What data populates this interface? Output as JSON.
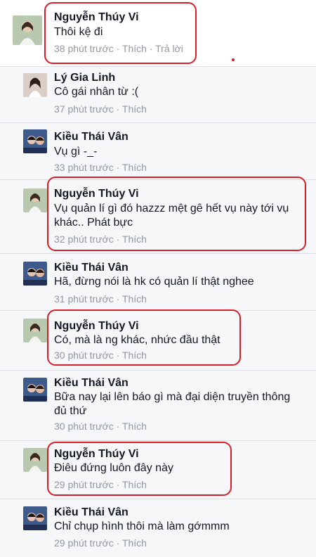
{
  "comments": [
    {
      "author": "Nguyễn Thúy Vi",
      "text": "Thôi kệ đi",
      "time": "38 phút trước",
      "like": "Thích",
      "reply": "Trả lời"
    },
    {
      "author": "Lý Gia Linh",
      "text": "Cô gái nhân từ :(",
      "time": "37 phút trước",
      "like": "Thích"
    },
    {
      "author": "Kiều Thái Vân",
      "text": "Vụ gì -_-",
      "time": "33 phút trước",
      "like": "Thích"
    },
    {
      "author": "Nguyễn Thúy Vi",
      "text": "Vụ quản lí gì đó hazzz mệt gê hết vụ này tới vụ",
      "text2": "khác.. Phát bực",
      "time": "32 phút trước",
      "like": "Thích"
    },
    {
      "author": "Kiều Thái Vân",
      "text": "Hã, đừng nói là hk có quản lí thật nghee",
      "time": "31 phút trước",
      "like": "Thích"
    },
    {
      "author": "Nguyễn Thúy Vi",
      "text": "Có, mà là ng khác, nhức đầu thật",
      "time": "30 phút trước",
      "like": "Thích"
    },
    {
      "author": "Kiều Thái Vân",
      "text": "Bữa nay lại lên báo gì mà đại diện truyền thông",
      "text2": "đủ thứ",
      "time": "30 phút trước",
      "like": "Thích"
    },
    {
      "author": "Nguyễn Thúy Vi",
      "text": "Điêu đứng luôn đây này",
      "time": "29 phút trước",
      "like": "Thích"
    },
    {
      "author": "Kiều Thái Vân",
      "text": "Chỉ chụp hình thôi mà làm gớmmm",
      "time": "29 phút trước",
      "like": "Thích"
    }
  ],
  "separator": "·",
  "colors": {
    "highlight": "#d81e28",
    "meta": "#9197a3",
    "text": "#141823"
  }
}
